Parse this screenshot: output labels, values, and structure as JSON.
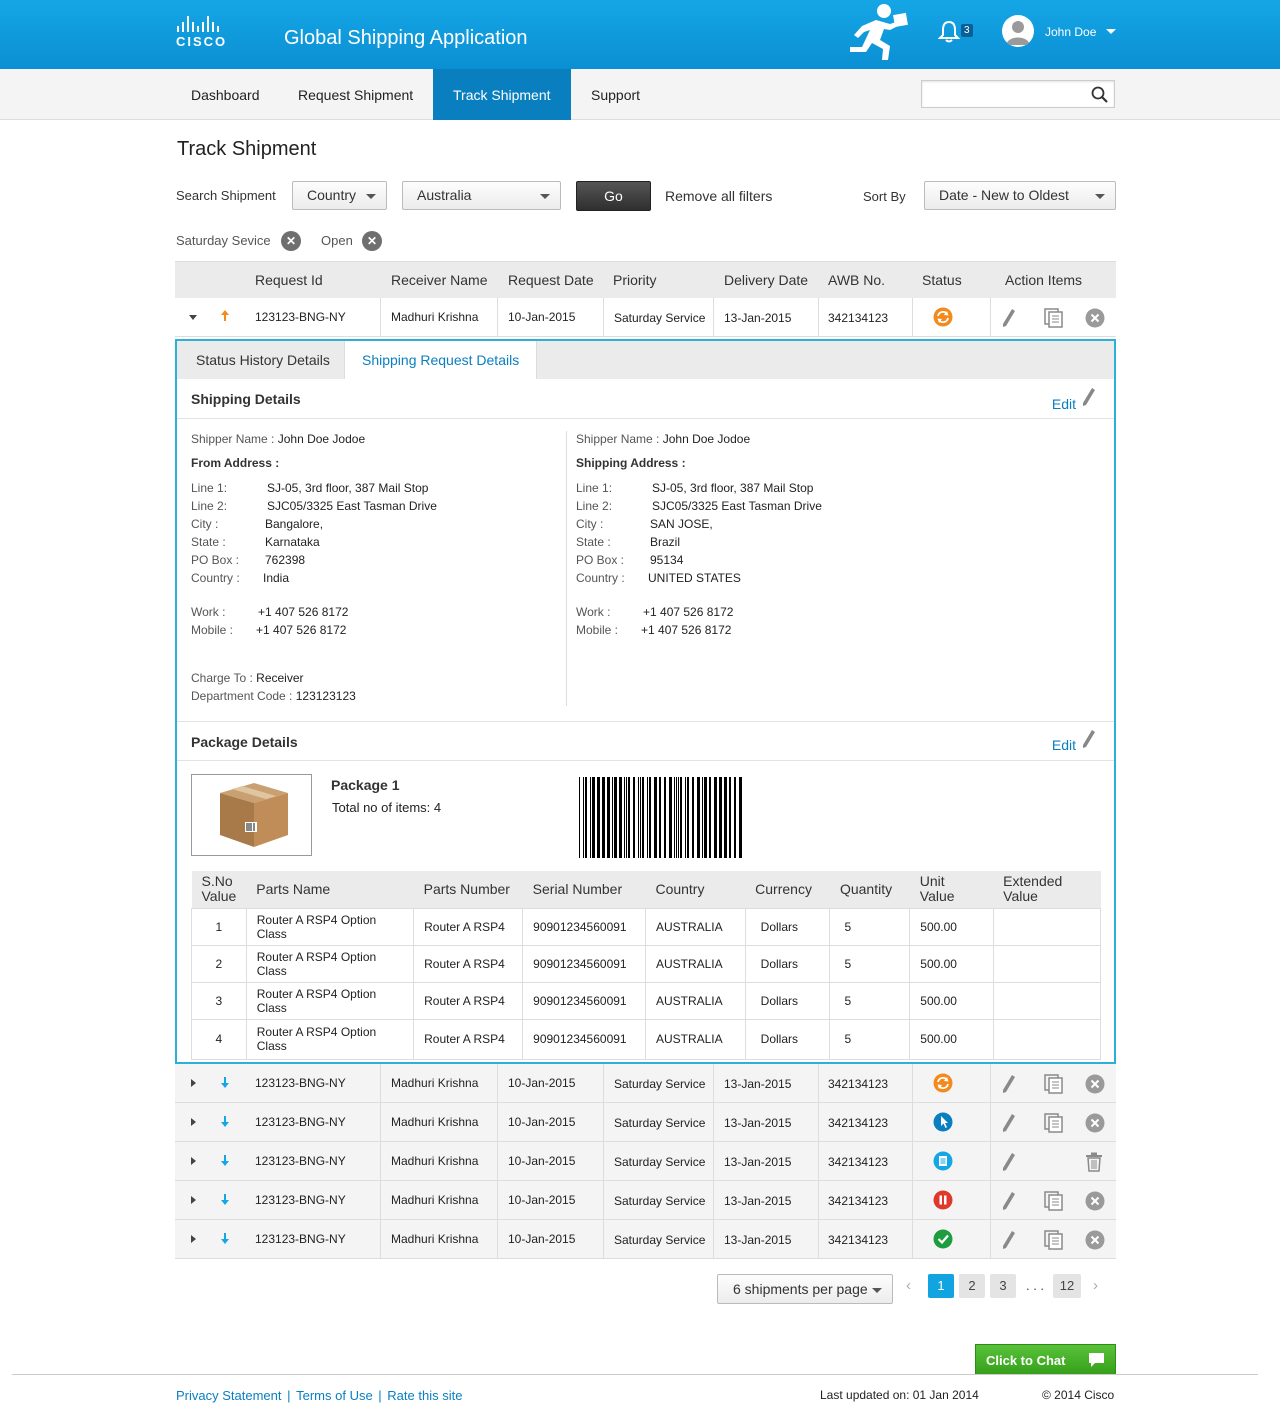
{
  "header": {
    "logo_text": "CISCO",
    "app_title": "Global Shipping Application",
    "notification_count": "3",
    "user_name": "John Doe"
  },
  "nav": {
    "items": [
      {
        "label": "Dashboard",
        "active": false
      },
      {
        "label": "Request Shipment",
        "active": false
      },
      {
        "label": "Track Shipment",
        "active": true
      },
      {
        "label": "Support",
        "active": false
      }
    ],
    "search_value": ""
  },
  "page_title": "Track Shipment",
  "filters": {
    "search_label": "Search Shipment",
    "field_select": "Country",
    "value_select": "Australia",
    "go_label": "Go",
    "remove_all": "Remove all filters",
    "sort_label": "Sort By",
    "sort_value": "Date - New to Oldest",
    "chips": [
      "Saturday Sevice",
      "Open"
    ]
  },
  "table": {
    "headers": [
      "Request Id",
      "Receiver Name",
      "Request Date",
      "Priority",
      "Delivery Date",
      "AWB No.",
      "Status",
      "Action Items"
    ],
    "rows": [
      {
        "id": "123123-BNG-NY",
        "receiver": "Madhuri Krishna",
        "request_date": "10-Jan-2015",
        "priority": "Saturday Service",
        "delivery_date": "13-Jan-2015",
        "awb": "342134123",
        "status_icon": "in-transit-icon",
        "status_color": "#f28a1e",
        "direction": "up",
        "expanded": true,
        "actions": [
          "edit-icon",
          "copy-icon",
          "cancel-icon"
        ]
      },
      {
        "id": "123123-BNG-NY",
        "receiver": "Madhuri Krishna",
        "request_date": "10-Jan-2015",
        "priority": "Saturday Service",
        "delivery_date": "13-Jan-2015",
        "awb": "342134123",
        "status_icon": "in-transit-icon",
        "status_color": "#f28a1e",
        "direction": "down",
        "expanded": false,
        "actions": [
          "edit-icon",
          "copy-icon",
          "cancel-icon"
        ]
      },
      {
        "id": "123123-BNG-NY",
        "receiver": "Madhuri Krishna",
        "request_date": "10-Jan-2015",
        "priority": "Saturday Service",
        "delivery_date": "13-Jan-2015",
        "awb": "342134123",
        "status_icon": "pointer-icon",
        "status_color": "#0a7fc0",
        "direction": "down",
        "expanded": false,
        "actions": [
          "edit-icon",
          "copy-icon",
          "cancel-icon"
        ]
      },
      {
        "id": "123123-BNG-NY",
        "receiver": "Madhuri Krishna",
        "request_date": "10-Jan-2015",
        "priority": "Saturday Service",
        "delivery_date": "13-Jan-2015",
        "awb": "342134123",
        "status_icon": "document-icon",
        "status_color": "#15a6e6",
        "direction": "down",
        "expanded": false,
        "actions": [
          "edit-icon",
          "trash-icon"
        ]
      },
      {
        "id": "123123-BNG-NY",
        "receiver": "Madhuri Krishna",
        "request_date": "10-Jan-2015",
        "priority": "Saturday Service",
        "delivery_date": "13-Jan-2015",
        "awb": "342134123",
        "status_icon": "pause-icon",
        "status_color": "#e0382b",
        "direction": "down",
        "expanded": false,
        "actions": [
          "edit-icon",
          "copy-icon",
          "cancel-icon"
        ]
      },
      {
        "id": "123123-BNG-NY",
        "receiver": "Madhuri Krishna",
        "request_date": "10-Jan-2015",
        "priority": "Saturday Service",
        "delivery_date": "13-Jan-2015",
        "awb": "342134123",
        "status_icon": "check-icon",
        "status_color": "#1e9d3f",
        "direction": "down",
        "expanded": false,
        "actions": [
          "edit-icon",
          "copy-icon",
          "cancel-icon"
        ]
      }
    ]
  },
  "detail": {
    "tabs": [
      "Status History Details",
      "Shipping Request Details"
    ],
    "active_tab": 1,
    "shipping_title": "Shipping Details",
    "edit_label": "Edit",
    "left": {
      "shipper_key": "Shipper Name :",
      "shipper": "John Doe Jodoe",
      "address_title": "From Address :",
      "line1_key": "Line 1:",
      "line1": "SJ-05, 3rd floor, 387 Mail Stop",
      "line2_key": "Line 2:",
      "line2": "SJC05/3325 East Tasman Drive",
      "city_key": "City   :",
      "city": "Bangalore,",
      "state_key": "State :",
      "state": "Karnataka",
      "po_key": "PO Box :",
      "po": "762398",
      "country_key": "Country :",
      "country": "India",
      "work_key": "Work    :",
      "work": "+1 407 526 8172",
      "mobile_key": "Mobile   :",
      "mobile": "+1 407 526 8172",
      "charge_key": "Charge To :",
      "charge": "Receiver",
      "dept_key": "Department Code :",
      "dept": "123123123"
    },
    "right": {
      "shipper_key": "Shipper Name :",
      "shipper": "John Doe Jodoe",
      "address_title": "Shipping Address :",
      "line1_key": "Line 1:",
      "line1": "SJ-05, 3rd floor, 387 Mail Stop",
      "line2_key": "Line 2:",
      "line2": "SJC05/3325 East Tasman Drive",
      "city_key": "City   :",
      "city": "SAN JOSE,",
      "state_key": "State :",
      "state": "Brazil",
      "po_key": "PO Box :",
      "po": "95134",
      "country_key": "Country :",
      "country": "UNITED STATES",
      "work_key": "Work    :",
      "work": "+1 407 526 8172",
      "mobile_key": "Mobile   :",
      "mobile": "+1 407 526 8172"
    },
    "package_title": "Package Details",
    "package_name": "Package 1",
    "package_items": "Total no of items: 4",
    "parts_headers": [
      "S.No Value",
      "Parts Name",
      "Parts Number",
      "Serial Number",
      "Country",
      "Currency",
      "Quantity",
      "Unit Value",
      "Extended Value"
    ],
    "parts": [
      [
        "1",
        "Router A RSP4 Option Class",
        "Router A RSP4",
        "90901234560091",
        "AUSTRALIA",
        "Dollars",
        "5",
        "500.00",
        ""
      ],
      [
        "2",
        "Router A RSP4 Option Class",
        "Router A RSP4",
        "90901234560091",
        "AUSTRALIA",
        "Dollars",
        "5",
        "500.00",
        ""
      ],
      [
        "3",
        "Router A RSP4 Option Class",
        "Router A RSP4",
        "90901234560091",
        "AUSTRALIA",
        "Dollars",
        "5",
        "500.00",
        ""
      ],
      [
        "4",
        "Router A RSP4 Option Class",
        "Router A RSP4",
        "90901234560091",
        "AUSTRALIA",
        "Dollars",
        "5",
        "500.00",
        ""
      ]
    ]
  },
  "pagination": {
    "per_page": "6 shipments per page",
    "pages": [
      "1",
      "2",
      "3",
      "12"
    ],
    "ellipsis": ". . .",
    "current": "1"
  },
  "chat_label": "Click to Chat",
  "footer": {
    "links": [
      "Privacy Statement",
      "Terms of Use",
      "Rate this site"
    ],
    "updated": "Last updated on: 01 Jan 2014",
    "copyright": "© 2014 Cisco"
  }
}
